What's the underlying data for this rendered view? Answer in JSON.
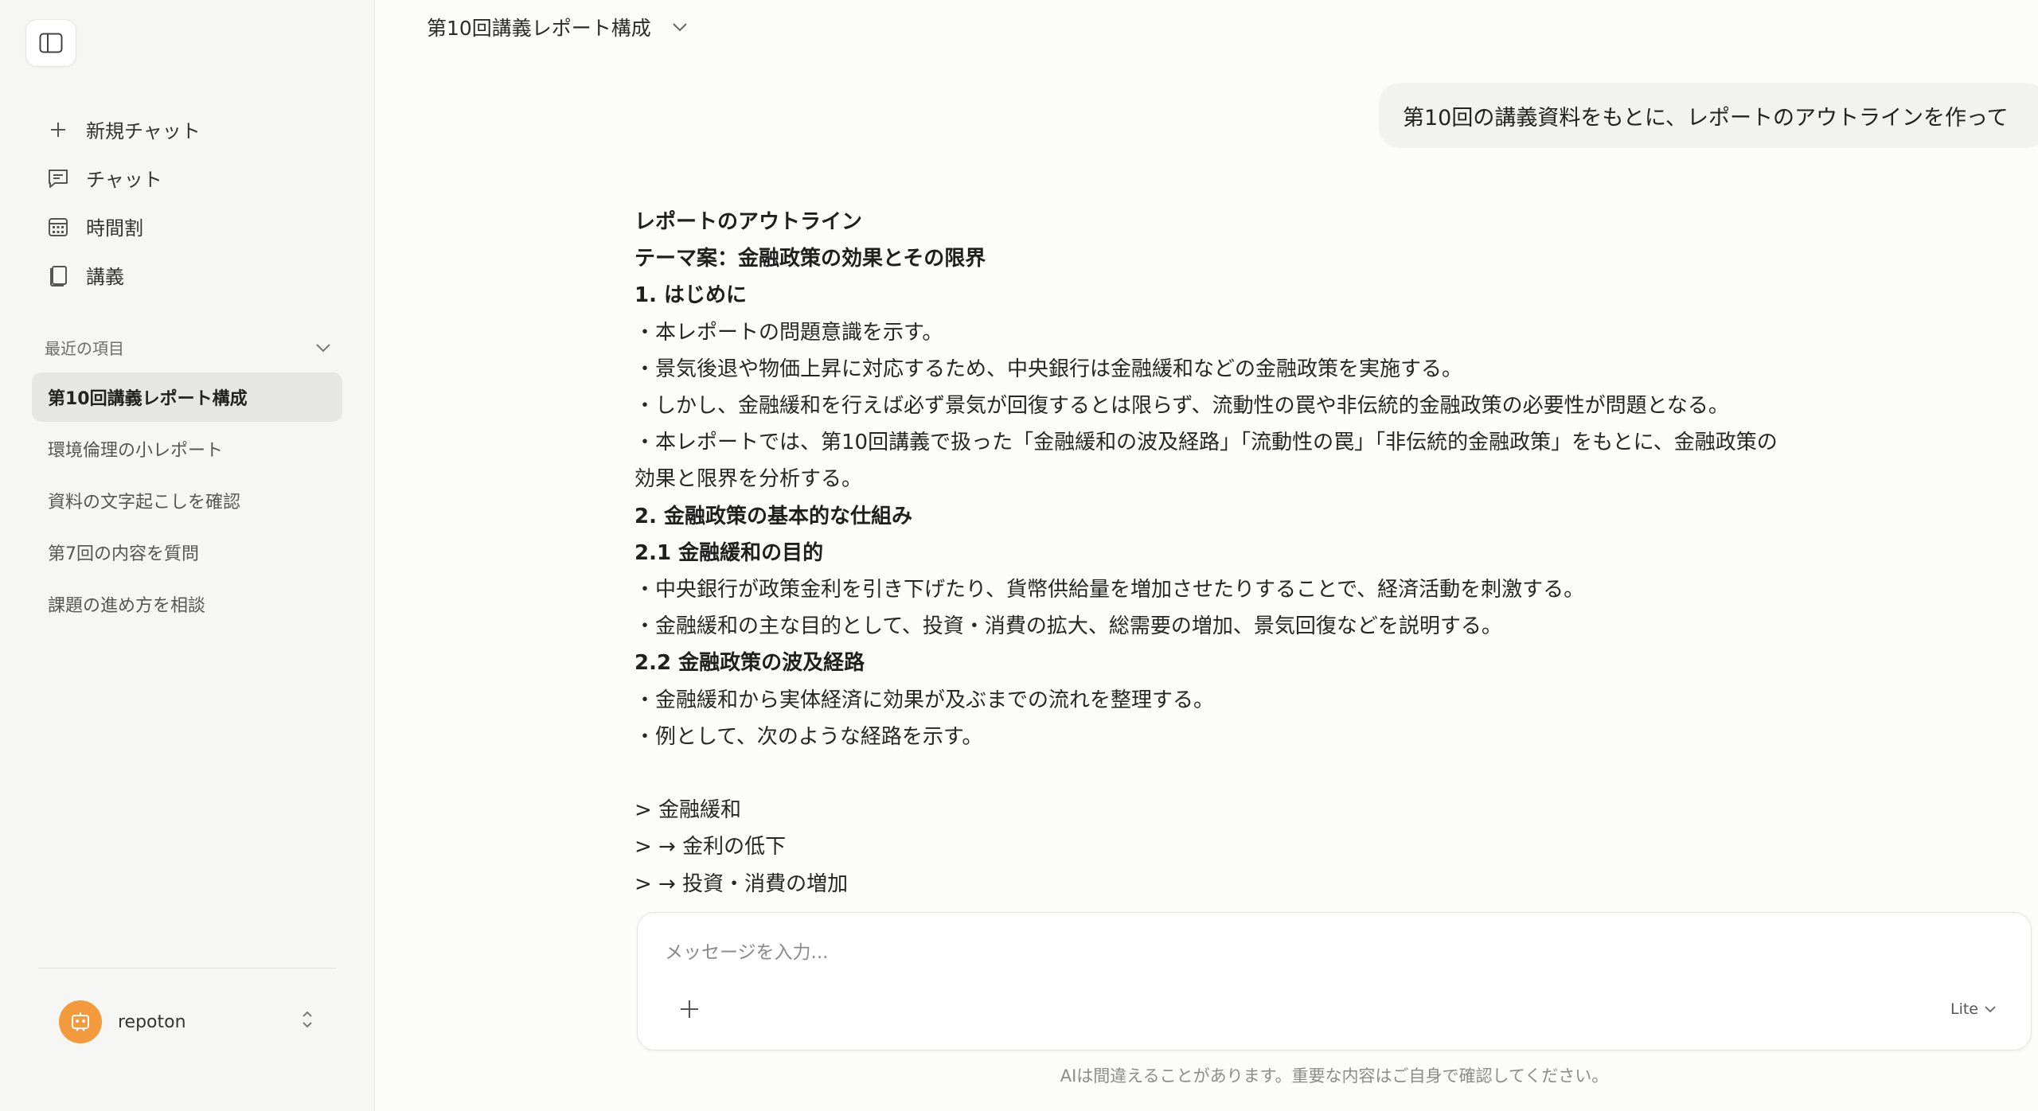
{
  "sidebar": {
    "nav": [
      {
        "label": "新規チャット",
        "icon": "plus-icon"
      },
      {
        "label": "チャット",
        "icon": "chat-icon"
      },
      {
        "label": "時間割",
        "icon": "calendar-icon"
      },
      {
        "label": "講義",
        "icon": "book-icon"
      }
    ],
    "recent_label": "最近の項目",
    "recent": [
      "第10回講義レポート構成",
      "環境倫理の小レポート",
      "資料の文字起こしを確認",
      "第7回の内容を質問",
      "課題の進め方を相談"
    ],
    "user": {
      "name": "repoton"
    }
  },
  "header": {
    "title": "第10回講義レポート構成"
  },
  "conversation": {
    "user_message": "第10回の講義資料をもとに、レポートのアウトラインを作って",
    "assistant_lines": [
      {
        "text": "レポートのアウトライン",
        "bold": true
      },
      {
        "text": "テーマ案：金融政策の効果とその限界",
        "bold": true
      },
      {
        "text": "1. はじめに",
        "bold": true
      },
      {
        "text": "・本レポートの問題意識を示す。",
        "bold": false
      },
      {
        "text": "・景気後退や物価上昇に対応するため、中央銀行は金融緩和などの金融政策を実施する。",
        "bold": false
      },
      {
        "text": "・しかし、金融緩和を行えば必ず景気が回復するとは限らず、流動性の罠や非伝統的金融政策の必要性が問題となる。",
        "bold": false
      },
      {
        "text": "・本レポートでは、第10回講義で扱った「金融緩和の波及経路」「流動性の罠」「非伝統的金融政策」をもとに、金融政策の",
        "bold": false
      },
      {
        "text": "効果と限界を分析する。",
        "bold": false
      },
      {
        "text": "2. 金融政策の基本的な仕組み",
        "bold": true
      },
      {
        "text": "2.1 金融緩和の目的",
        "bold": true
      },
      {
        "text": "・中央銀行が政策金利を引き下げたり、貨幣供給量を増加させたりすることで、経済活動を刺激する。",
        "bold": false
      },
      {
        "text": "・金融緩和の主な目的として、投資・消費の拡大、総需要の増加、景気回復などを説明する。",
        "bold": false
      },
      {
        "text": "2.2 金融政策の波及経路",
        "bold": true
      },
      {
        "text": "・金融緩和から実体経済に効果が及ぶまでの流れを整理する。",
        "bold": false
      },
      {
        "text": "・例として、次のような経路を示す。",
        "bold": false
      },
      {
        "text": "",
        "bold": false
      },
      {
        "text": "> 金融緩和",
        "bold": false
      },
      {
        "text": "> → 金利の低下",
        "bold": false
      },
      {
        "text": "> → 投資・消費の増加",
        "bold": false
      }
    ]
  },
  "composer": {
    "placeholder": "メッセージを入力...",
    "model": "Lite",
    "disclaimer": "AIは間違えることがあります。重要な内容はご自身で確認してください。"
  },
  "colors": {
    "avatar": "#f39a3c",
    "active_item_bg": "#e6e6e4",
    "sidebar_bg": "#f6f6f5"
  }
}
